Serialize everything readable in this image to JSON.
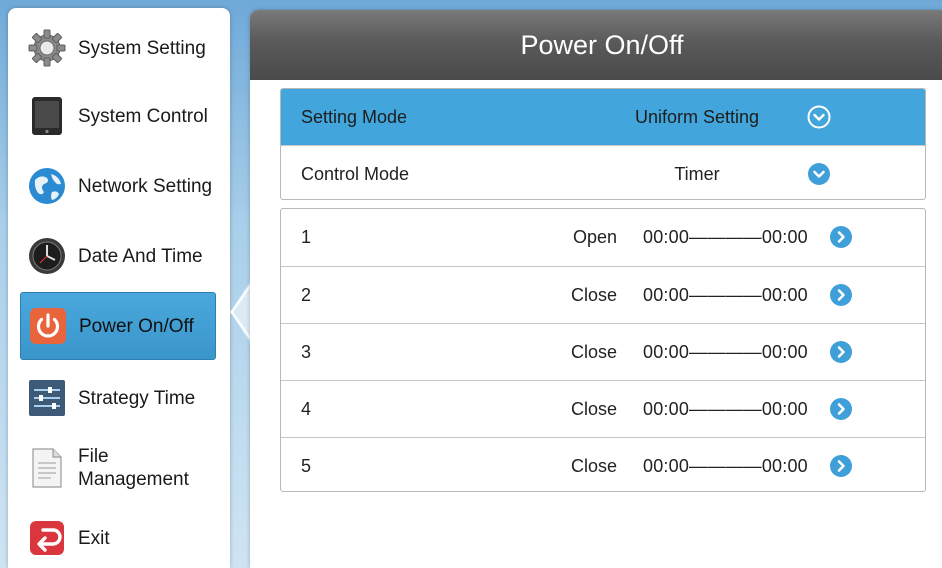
{
  "sidebar": {
    "items": [
      {
        "label": "System Setting",
        "icon": "gear-icon"
      },
      {
        "label": "System Control",
        "icon": "tablet-icon"
      },
      {
        "label": "Network Setting",
        "icon": "globe-icon"
      },
      {
        "label": "Date And Time",
        "icon": "clock-icon"
      },
      {
        "label": "Power On/Off",
        "icon": "power-icon"
      },
      {
        "label": "Strategy Time",
        "icon": "sliders-icon"
      },
      {
        "label": "File Management",
        "icon": "document-icon"
      },
      {
        "label": "Exit",
        "icon": "exit-icon"
      }
    ],
    "active": "Power On/Off"
  },
  "main": {
    "title": "Power On/Off",
    "settings": [
      {
        "label": "Setting Mode",
        "value": "Uniform Setting"
      },
      {
        "label": "Control Mode",
        "value": "Timer"
      }
    ],
    "timers": [
      {
        "index": "1",
        "state": "Open",
        "time": "00:00————00:00"
      },
      {
        "index": "2",
        "state": "Close",
        "time": "00:00————00:00"
      },
      {
        "index": "3",
        "state": "Close",
        "time": "00:00————00:00"
      },
      {
        "index": "4",
        "state": "Close",
        "time": "00:00————00:00"
      },
      {
        "index": "5",
        "state": "Close",
        "time": "00:00————00:00"
      }
    ]
  },
  "colors": {
    "accent": "#42a6dc",
    "header": "#5a5a5a",
    "power": "#e8643a",
    "exit": "#d9363e"
  }
}
